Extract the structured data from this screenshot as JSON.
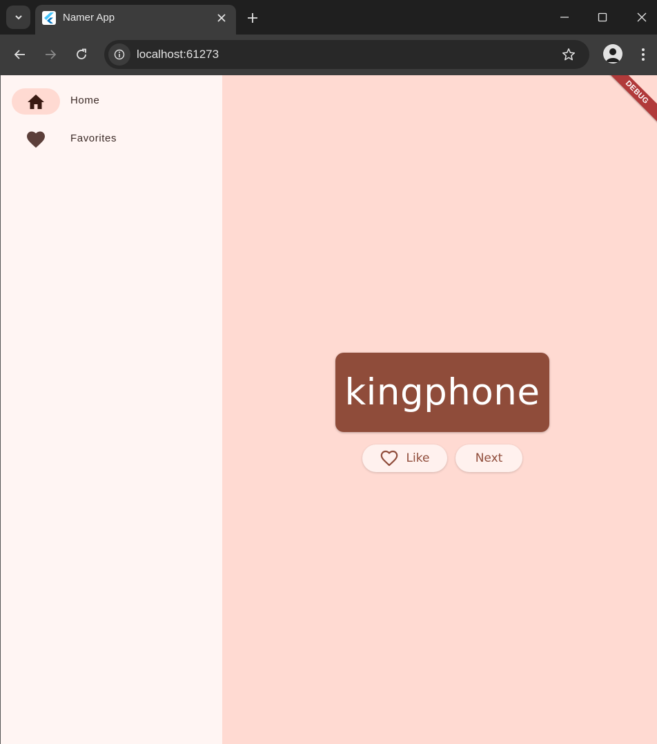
{
  "browser": {
    "tab_title": "Namer App",
    "url": "localhost:61273"
  },
  "nav": {
    "items": [
      {
        "label": "Home",
        "icon": "home-icon",
        "selected": true
      },
      {
        "label": "Favorites",
        "icon": "heart-icon",
        "selected": false
      }
    ]
  },
  "main": {
    "word": "kingphone",
    "like_label": "Like",
    "next_label": "Next",
    "debug_label": "DEBUG"
  },
  "colors": {
    "primary": "#8f4c3a",
    "rail_bg": "#fff5f3",
    "main_bg": "#ffdad2",
    "indicator": "#ffdad2"
  }
}
